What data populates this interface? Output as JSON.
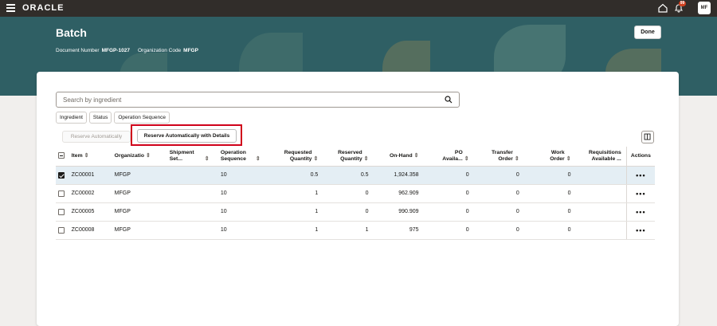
{
  "app": {
    "logo": "ORACLE",
    "notification_count": "99",
    "avatar_initials": "MF"
  },
  "header": {
    "title": "Batch",
    "document_number_label": "Document Number",
    "document_number": "MFGP-1027",
    "org_code_label": "Organization Code",
    "org_code": "MFGP",
    "done_label": "Done"
  },
  "search": {
    "placeholder": "Search by ingredient",
    "value": ""
  },
  "filters": [
    "Ingredient",
    "Status",
    "Operation Sequence"
  ],
  "toolbar": {
    "reserve_auto_label": "Reserve Automatically",
    "reserve_details_label": "Reserve Automatically with Details"
  },
  "table": {
    "headers": {
      "item": "Item",
      "organization": "Organizatio",
      "shipment": "Shipment Set...",
      "operation": "Operation Sequence",
      "requested": "Requested Quantity",
      "reserved": "Reserved Quantity",
      "onhand": "On-Hand",
      "po": "PO Availa...",
      "transfer": "Transfer Order",
      "work": "Work Order",
      "requisitions": "Requisitions Available ...",
      "actions": "Actions"
    },
    "rows": [
      {
        "item": "ZC00001",
        "org": "MFGP",
        "shipment": "",
        "op": "10",
        "requested": "0.5",
        "reserved": "0.5",
        "onhand": "1,924.358",
        "po": "0",
        "transfer": "0",
        "work": "0",
        "req": "",
        "selected": true
      },
      {
        "item": "ZC00002",
        "org": "MFGP",
        "shipment": "",
        "op": "10",
        "requested": "1",
        "reserved": "0",
        "onhand": "962.909",
        "po": "0",
        "transfer": "0",
        "work": "0",
        "req": "",
        "selected": false
      },
      {
        "item": "ZC00005",
        "org": "MFGP",
        "shipment": "",
        "op": "10",
        "requested": "1",
        "reserved": "0",
        "onhand": "990.909",
        "po": "0",
        "transfer": "0",
        "work": "0",
        "req": "",
        "selected": false
      },
      {
        "item": "ZC00008",
        "org": "MFGP",
        "shipment": "",
        "op": "10",
        "requested": "1",
        "reserved": "1",
        "onhand": "975",
        "po": "0",
        "transfer": "0",
        "work": "0",
        "req": "",
        "selected": false
      }
    ],
    "actions_glyph": "•••"
  },
  "colors": {
    "topbar": "#312d2a",
    "banner": "#2f5f64",
    "highlight": "#d0021b",
    "selected_row": "#e4eef4"
  }
}
